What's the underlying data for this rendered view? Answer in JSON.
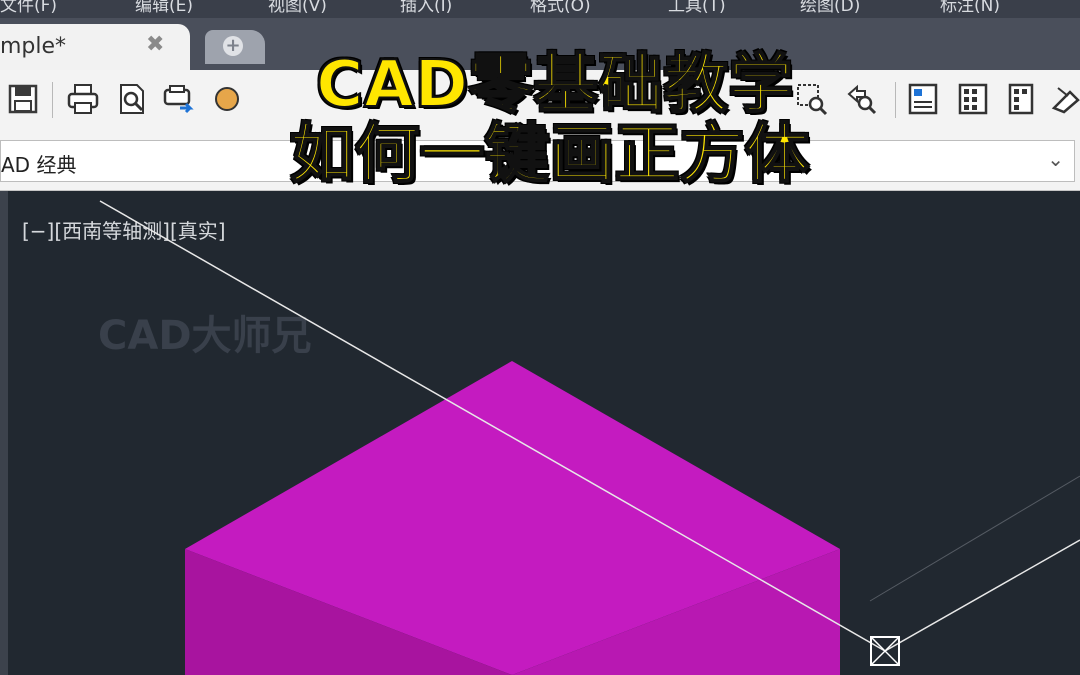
{
  "menu": [
    "文件(F)",
    "编辑(E)",
    "视图(V)",
    "插入(I)",
    "格式(O)",
    "工具(T)",
    "绘图(D)",
    "标注(N)"
  ],
  "tab": {
    "label": "mple*",
    "close": "✖",
    "new_icon": "+"
  },
  "toolbar": {
    "icons": [
      "save-icon",
      "print-icon",
      "print-preview-icon",
      "plot-icon",
      "publish-icon",
      "zoom-window-icon",
      "zoom-previous-icon",
      "properties-icon",
      "design-center-icon",
      "tool-palettes-icon",
      "match-properties-icon"
    ]
  },
  "workspace": {
    "value": "AD 经典",
    "caret": "⌄"
  },
  "viewport": {
    "label": "[−][西南等轴测][真实]",
    "watermark": "CAD大师兄",
    "background": "#212830",
    "solid_color": "#c41bc0"
  },
  "overlay": {
    "line1": "CAD零基础教学",
    "line2": "如何一键画正方体",
    "color": "#ffe600"
  }
}
